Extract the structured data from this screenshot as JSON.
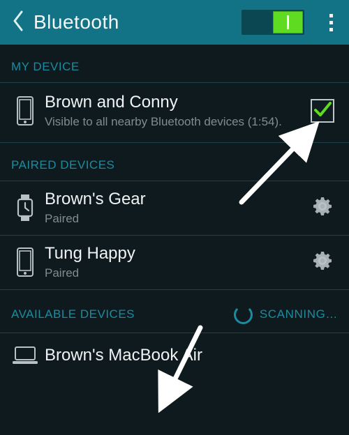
{
  "header": {
    "title": "Bluetooth",
    "toggle_on": true
  },
  "sections": {
    "my_device_label": "MY DEVICE",
    "paired_devices_label": "PAIRED DEVICES",
    "available_devices_label": "AVAILABLE DEVICES",
    "scanning_label": "SCANNING…"
  },
  "my_device": {
    "name": "Brown and Conny",
    "subtitle": "Visible to all nearby Bluetooth devices (1:54).",
    "checked": true
  },
  "paired": [
    {
      "name": "Brown's Gear",
      "status": "Paired",
      "icon": "watch"
    },
    {
      "name": "Tung Happy",
      "status": "Paired",
      "icon": "phone"
    }
  ],
  "available": [
    {
      "name": "Brown's MacBook Air",
      "icon": "laptop"
    }
  ],
  "colors": {
    "accent": "#5fdc21",
    "teal": "#127386",
    "section": "#1b8ca0",
    "bg": "#0e1a1e"
  }
}
